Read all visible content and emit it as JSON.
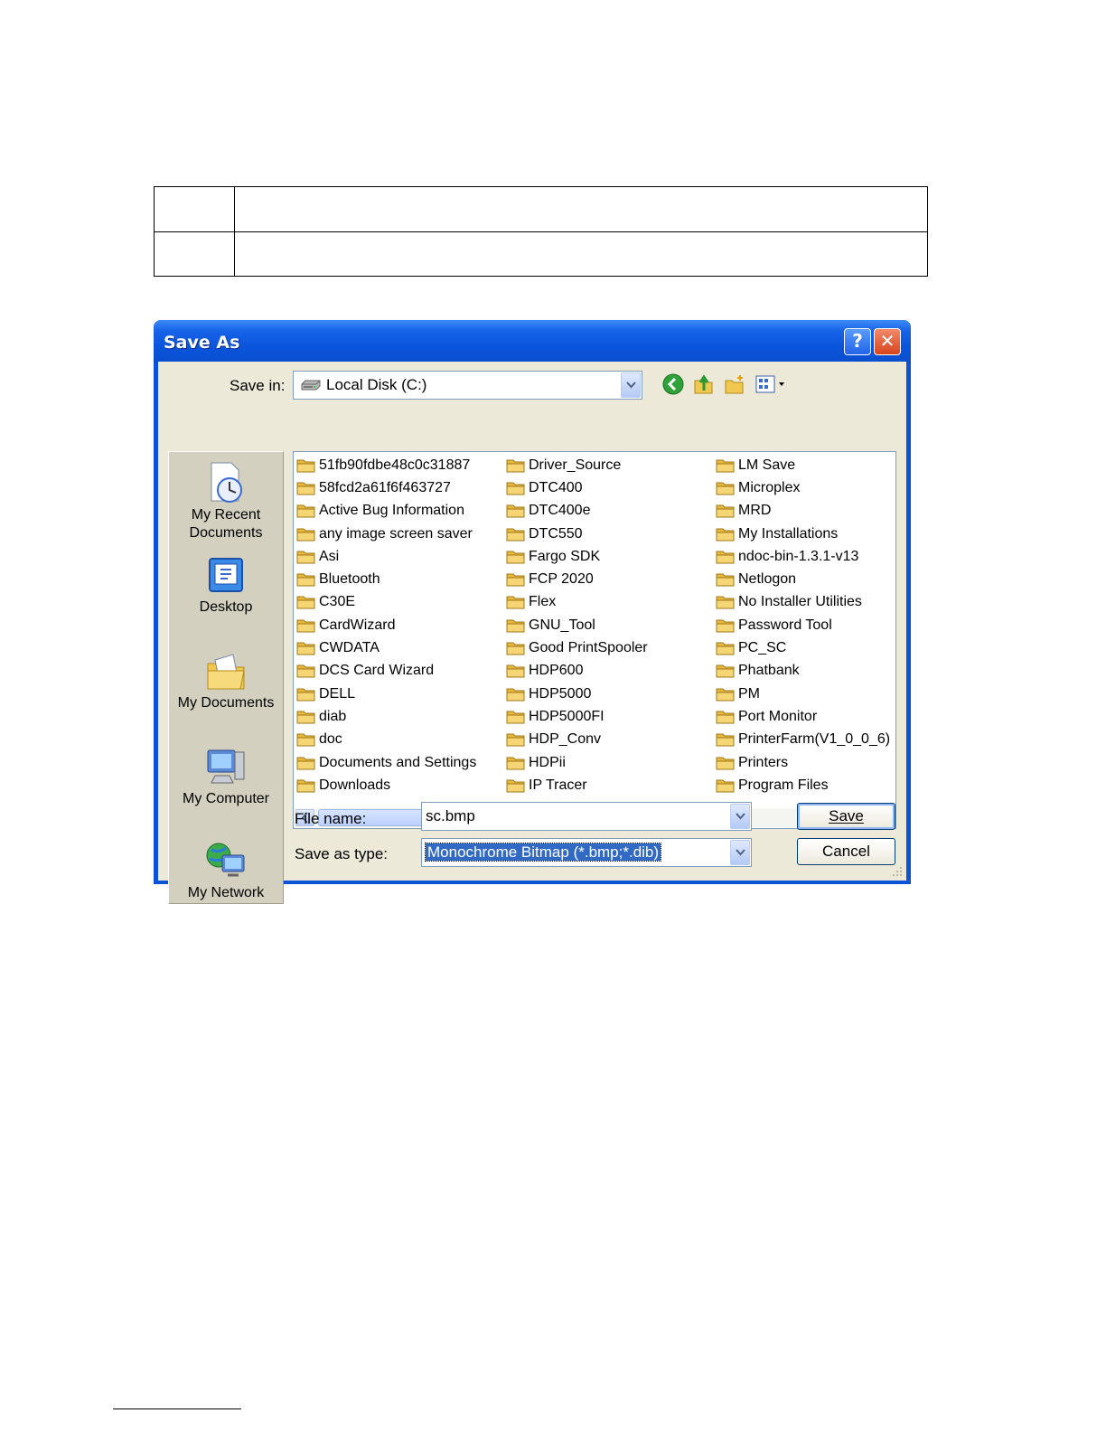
{
  "dialog": {
    "title": "Save As",
    "help_glyph": "?",
    "close_glyph": "✕"
  },
  "save_in": {
    "label": "Save in:",
    "value": "Local Disk (C:)"
  },
  "toolbar": {
    "icons": [
      "back-icon",
      "up-folder-icon",
      "new-folder-icon",
      "views-menu-icon"
    ]
  },
  "places": [
    {
      "label_line1": "My Recent",
      "label_line2": "Documents",
      "icon": "my-recent-documents-icon"
    },
    {
      "label_line1": "Desktop",
      "label_line2": "",
      "icon": "desktop-icon"
    },
    {
      "label_line1": "My Documents",
      "label_line2": "",
      "icon": "my-documents-icon"
    },
    {
      "label_line1": "My Computer",
      "label_line2": "",
      "icon": "my-computer-icon"
    },
    {
      "label_line1": "My Network",
      "label_line2": "",
      "icon": "my-network-icon"
    }
  ],
  "files": {
    "col1": [
      "51fb90fdbe48c0c31887",
      "58fcd2a61f6f463727",
      "Active Bug Information",
      "any image screen saver",
      "Asi",
      "Bluetooth",
      "C30E",
      "CardWizard",
      "CWDATA",
      "DCS Card Wizard",
      "DELL",
      "diab",
      "doc",
      "Documents and Settings",
      "Downloads"
    ],
    "col2": [
      "Driver_Source",
      "DTC400",
      "DTC400e",
      "DTC550",
      "Fargo SDK",
      "FCP 2020",
      "Flex",
      "GNU_Tool",
      "Good PrintSpooler",
      "HDP600",
      "HDP5000",
      "HDP5000FI",
      "HDP_Conv",
      "HDPii",
      "IP Tracer"
    ],
    "col3": [
      "LM Save",
      "Microplex",
      "MRD",
      "My Installations",
      "ndoc-bin-1.3.1-v13",
      "Netlogon",
      "No Installer Utilities",
      "Password Tool",
      "PC_SC",
      "Phatbank",
      "PM",
      "Port Monitor",
      "PrinterFarm(V1_0_0_6)",
      "Printers",
      "Program Files"
    ]
  },
  "file_name": {
    "label": "File name:",
    "value": "sc.bmp"
  },
  "save_as_type": {
    "label": "Save as type:",
    "value": "Monochrome Bitmap (*.bmp;*.dib)"
  },
  "buttons": {
    "save": "Save",
    "cancel": "Cancel"
  },
  "colors": {
    "title_bar": "#0a55dc",
    "dialog_face": "#ece9d8",
    "folder": "#f0c850",
    "selection": "#316ac5"
  }
}
